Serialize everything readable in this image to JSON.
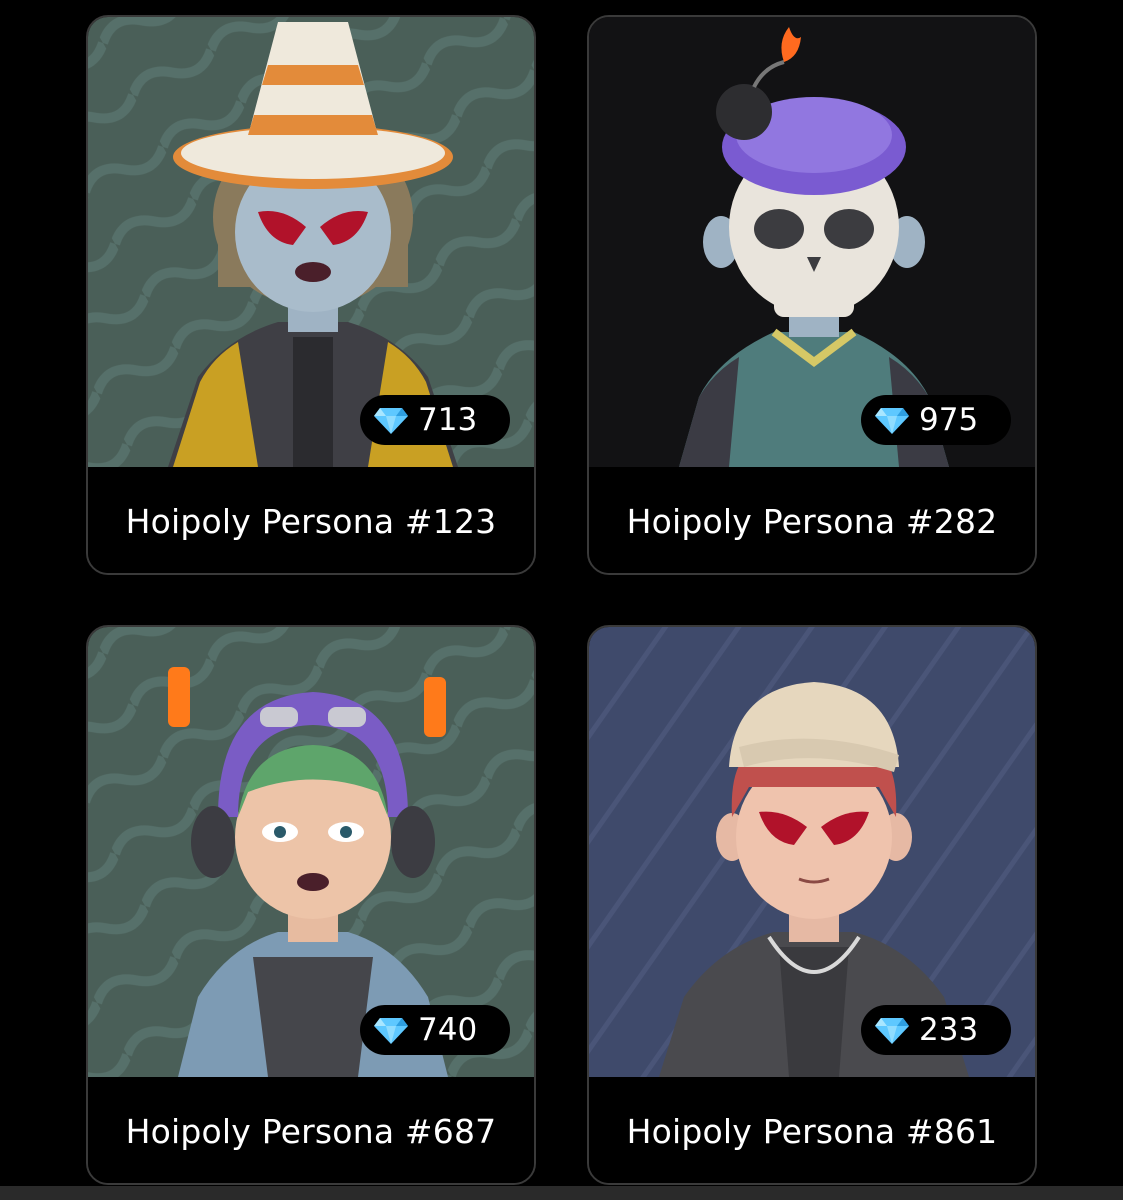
{
  "cards": [
    {
      "name": "Hoipoly Persona #123",
      "price": "713",
      "bg": "#4a5f58",
      "stripe": "#56706a"
    },
    {
      "name": "Hoipoly Persona #282",
      "price": "975",
      "bg": "#121214",
      "stripe": "#121214"
    },
    {
      "name": "Hoipoly Persona #687",
      "price": "740",
      "bg": "#4a5f58",
      "stripe": "#56706a"
    },
    {
      "name": "Hoipoly Persona #861",
      "price": "233",
      "bg": "#3f4a6b",
      "stripe": "#4a5578"
    }
  ],
  "currency_icon": "diamond-icon",
  "colors": {
    "accent_diamond": "#5ec8ff",
    "card_border": "#3a3a3a",
    "page_bg": "#000000"
  }
}
